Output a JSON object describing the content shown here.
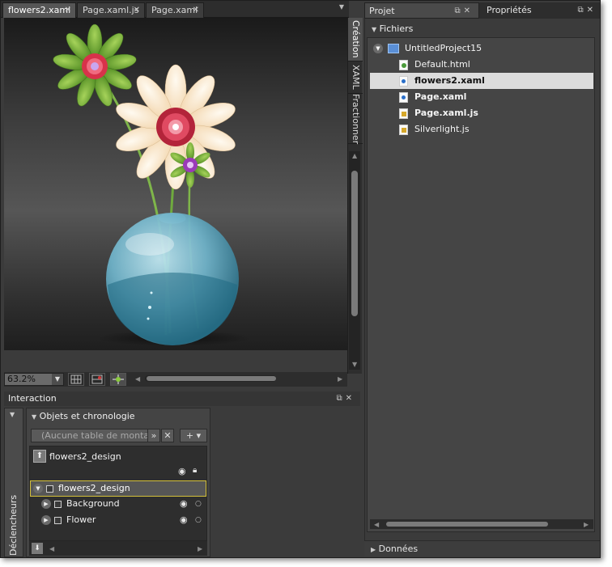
{
  "document_tabs": [
    {
      "label": "flowers2.xaml",
      "active": true
    },
    {
      "label": "Page.xaml.js",
      "active": false
    },
    {
      "label": "Page.xaml",
      "active": false
    }
  ],
  "artboard_view_tabs": [
    "Création",
    "XAML",
    "Fractionner"
  ],
  "zoom": {
    "value": "63.2%"
  },
  "interaction_panel": {
    "title": "Interaction",
    "triggers_label": "Déclencheurs",
    "objects_section_title": "Objets et chronologie",
    "storyboard_placeholder": "(Aucune table de montage",
    "root": {
      "label": "flowers2_design"
    },
    "tree": [
      {
        "label": "flowers2_design",
        "selected": true
      },
      {
        "label": "Background",
        "selected": false
      },
      {
        "label": "Flower",
        "selected": false
      }
    ]
  },
  "right_panel": {
    "tabs": [
      {
        "label": "Projet",
        "active": true
      },
      {
        "label": "Propriétés",
        "active": false
      }
    ],
    "files_section_title": "Fichiers",
    "project_name": "UntitledProject15",
    "files": [
      {
        "name": "Default.html",
        "type": "html",
        "bold": false,
        "selected": false
      },
      {
        "name": "flowers2.xaml",
        "type": "xaml",
        "bold": true,
        "selected": true
      },
      {
        "name": "Page.xaml",
        "type": "xaml",
        "bold": true,
        "selected": false
      },
      {
        "name": "Page.xaml.js",
        "type": "js",
        "bold": true,
        "selected": false
      },
      {
        "name": "Silverlight.js",
        "type": "js",
        "bold": false,
        "selected": false
      }
    ],
    "data_section_title": "Données"
  },
  "icons": {
    "close": "close-icon",
    "dock": "dock-icon",
    "eye": "eye-icon",
    "lock": "lock-icon",
    "expand": "triangle-icon"
  },
  "colors": {
    "panel_bg": "#3b3b3b",
    "selected_row_outline": "#d4c03a",
    "file_selected_bg": "#dcdcdc"
  }
}
